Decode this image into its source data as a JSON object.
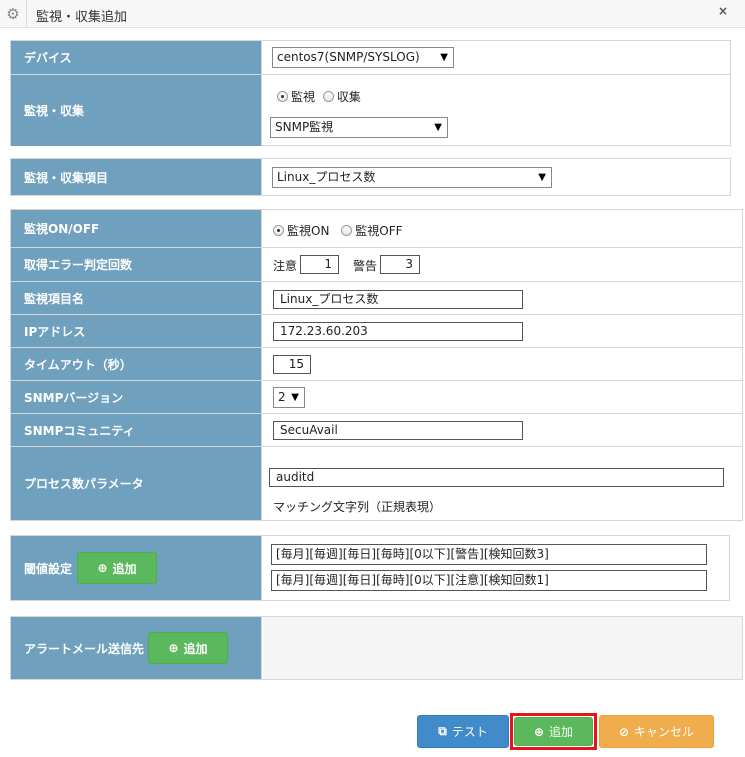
{
  "window": {
    "title": "監視・収集追加",
    "close_label": "×",
    "icon": "gear-icon"
  },
  "device": {
    "label": "デバイス",
    "value": "centos7(SNMP/SYSLOG)"
  },
  "monitor_collect": {
    "label": "監視・収集",
    "option_monitor": "監視",
    "option_collect": "収集",
    "selected": "監視",
    "type_value": "SNMP監視"
  },
  "item": {
    "label": "監視・収集項目",
    "value": "Linux_プロセス数"
  },
  "monitor_onoff": {
    "label": "監視ON/OFF",
    "option_on": "監視ON",
    "option_off": "監視OFF",
    "selected": "監視ON"
  },
  "error_count": {
    "label": "取得エラー判定回数",
    "caution_label": "注意",
    "caution_value": "1",
    "warning_label": "警告",
    "warning_value": "3"
  },
  "item_name": {
    "label": "監視項目名",
    "value": "Linux_プロセス数"
  },
  "ip": {
    "label": "IPアドレス",
    "value": "172.23.60.203"
  },
  "timeout": {
    "label": "タイムアウト（秒）",
    "value": "15"
  },
  "snmp_version": {
    "label": "SNMPバージョン",
    "value": "2"
  },
  "snmp_community": {
    "label": "SNMPコミュニティ",
    "value": "SecuAvail"
  },
  "process_param": {
    "label": "プロセス数パラメータ",
    "value": "auditd",
    "hint": "マッチング文字列（正規表現）"
  },
  "threshold": {
    "label": "閾値設定",
    "add_label": "追加",
    "entries": [
      "[毎月][毎週][毎日][毎時][0以下][警告][検知回数3]",
      "[毎月][毎週][毎日][毎時][0以下][注意][検知回数1]"
    ]
  },
  "alert_mail": {
    "label": "アラートメール送信先",
    "add_label": "追加"
  },
  "footer": {
    "test_label": "テスト",
    "add_label": "追加",
    "cancel_label": "キャンセル"
  }
}
